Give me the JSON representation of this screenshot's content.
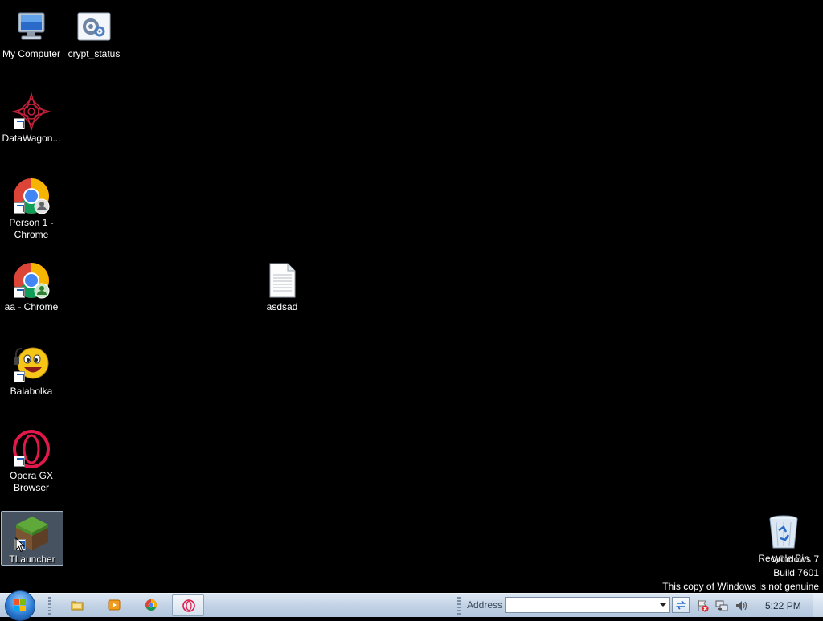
{
  "desktop": {
    "icons": [
      {
        "label": "My Computer",
        "icon": "computer-icon"
      },
      {
        "label": "crypt_status",
        "icon": "settings-file-icon"
      },
      {
        "label": "DataWagon...",
        "icon": "datawagon-icon"
      },
      {
        "label": "Person 1 - Chrome",
        "icon": "chrome-icon"
      },
      {
        "label": "aa - Chrome",
        "icon": "chrome-icon"
      },
      {
        "label": "Balabolka",
        "icon": "balabolka-icon"
      },
      {
        "label": "Opera GX Browser",
        "icon": "opera-icon"
      },
      {
        "label": "TLauncher",
        "icon": "minecraft-grass-icon"
      },
      {
        "label": "asdsad",
        "icon": "text-file-icon"
      },
      {
        "label": "Recycle Bin",
        "icon": "recycle-bin-icon"
      }
    ]
  },
  "watermark": {
    "line1": "Windows 7",
    "line2": "Build 7601",
    "line3": "This copy of Windows is not genuine"
  },
  "taskbar": {
    "address_label": "Address",
    "address_value": "",
    "clock": "5:22 PM",
    "pinned": [
      "explorer-icon",
      "media-player-icon",
      "chrome-icon",
      "opera-icon"
    ]
  }
}
